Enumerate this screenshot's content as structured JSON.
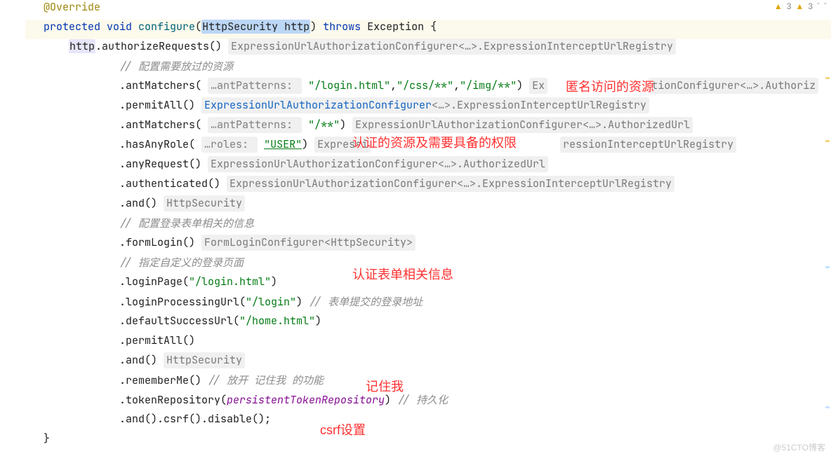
{
  "warnings": {
    "w1": "3",
    "w2": "3"
  },
  "annotations": {
    "anon": "匿名访问的资源",
    "auth": "认证的资源及需要具备的权限",
    "form": "认证表单相关信息",
    "remember": "记住我",
    "csrf": "csrf设置"
  },
  "code": {
    "l0": "@Override",
    "l1_kw": "protected void ",
    "l1_m": "configure",
    "l1_p": "HttpSecurity http",
    "l1_throws": " throws ",
    "l1_exc": "Exception {",
    "l2_a": "http",
    "l2_b": ".authorizeRequests() ",
    "l2_h": "ExpressionUrlAuthorizationConfigurer<…>.ExpressionInterceptUrlRegistry",
    "l3": "// 配置需要放过的资源",
    "l4_a": ".antMatchers( ",
    "l4_hkey": "…antPatterns: ",
    "l4_s1": "\"/login.html\"",
    "l4_s2": "\"/css/**\"",
    "l4_s3": "\"/img/**\"",
    "l4_b": ") ",
    "l4_h1": "Ex",
    "l4_h2": "tionConfigurer<…>.Authoriz",
    "l5_a": ".permitAll() ",
    "l5_h1": "ExpressionUrlAuthorizationConfigurer",
    "l5_h2": "<…>.ExpressionInterceptUrlRegistry",
    "l6_a": ".antMatchers( ",
    "l6_hkey": "…antPatterns: ",
    "l6_s": "\"/**\"",
    "l6_b": ") ",
    "l6_h": "ExpressionUrlAuthorizationConfigurer<…>.AuthorizedUrl",
    "l7_a": ".hasAnyRole( ",
    "l7_hkey": "…roles: ",
    "l7_s": "\"USER\"",
    "l7_b": ") ",
    "l7_h1": "Expressi",
    "l7_h2": "ressionInterceptUrlRegistry",
    "l8_a": ".anyRequest() ",
    "l8_h": "ExpressionUrlAuthorizationConfigurer<…>.AuthorizedUrl",
    "l9_a": ".authenticated() ",
    "l9_h": "ExpressionUrlAuthorizationConfigurer<…>.ExpressionInterceptUrlRegistry",
    "l10_a": ".and() ",
    "l10_h": "HttpSecurity",
    "l11": "// 配置登录表单相关的信息",
    "l12_a": ".formLogin() ",
    "l12_h": "FormLoginConfigurer<HttpSecurity>",
    "l13": "// 指定自定义的登录页面",
    "l14_a": ".loginPage(",
    "l14_s": "\"/login.html\"",
    "l14_b": ")",
    "l15_a": ".loginProcessingUrl(",
    "l15_s": "\"/login\"",
    "l15_b": ") ",
    "l15_c": "// 表单提交的登录地址",
    "l16_a": ".defaultSuccessUrl(",
    "l16_s": "\"/home.html\"",
    "l16_b": ")",
    "l17": ".permitAll()",
    "l18_a": ".and() ",
    "l18_h": "HttpSecurity",
    "l19_a": ".rememberMe() ",
    "l19_c": "// 放开 记住我 的功能",
    "l20_a": ".tokenRepository(",
    "l20_p": "persistentTokenRepository",
    "l20_b": ") ",
    "l20_c": "// 持久化",
    "l21": ".and().csrf().disable();",
    "l22": "}"
  },
  "watermark": "@51CTO博客"
}
